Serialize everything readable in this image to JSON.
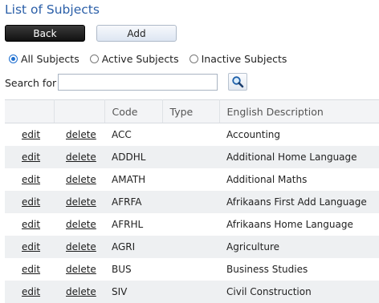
{
  "page": {
    "title": "List of Subjects"
  },
  "toolbar": {
    "back_label": "Back",
    "add_label": "Add"
  },
  "filters": {
    "options": [
      {
        "label": "All Subjects",
        "selected": true
      },
      {
        "label": "Active Subjects",
        "selected": false
      },
      {
        "label": "Inactive Subjects",
        "selected": false
      }
    ]
  },
  "search": {
    "label": "Search for",
    "value": "",
    "icon": "magnifier-icon"
  },
  "table": {
    "columns": [
      "",
      "",
      "Code",
      "Type",
      "English Description"
    ],
    "edit_label": "edit",
    "delete_label": "delete",
    "rows": [
      {
        "code": "ACC",
        "type": "",
        "description": "Accounting"
      },
      {
        "code": "ADDHL",
        "type": "",
        "description": "Additional Home Language"
      },
      {
        "code": "AMATH",
        "type": "",
        "description": "Additional Maths"
      },
      {
        "code": "AFRFA",
        "type": "",
        "description": "Afrikaans First Add Language"
      },
      {
        "code": "AFRHL",
        "type": "",
        "description": "Afrikaans Home Language"
      },
      {
        "code": "AGRI",
        "type": "",
        "description": "Agriculture"
      },
      {
        "code": "BUS",
        "type": "",
        "description": "Business Studies"
      },
      {
        "code": "SIV",
        "type": "",
        "description": "Civil Construction"
      }
    ]
  },
  "colors": {
    "title": "#2b5fa8",
    "radio_selected": "#1e6fd0",
    "row_alt": "#eef0f2"
  }
}
